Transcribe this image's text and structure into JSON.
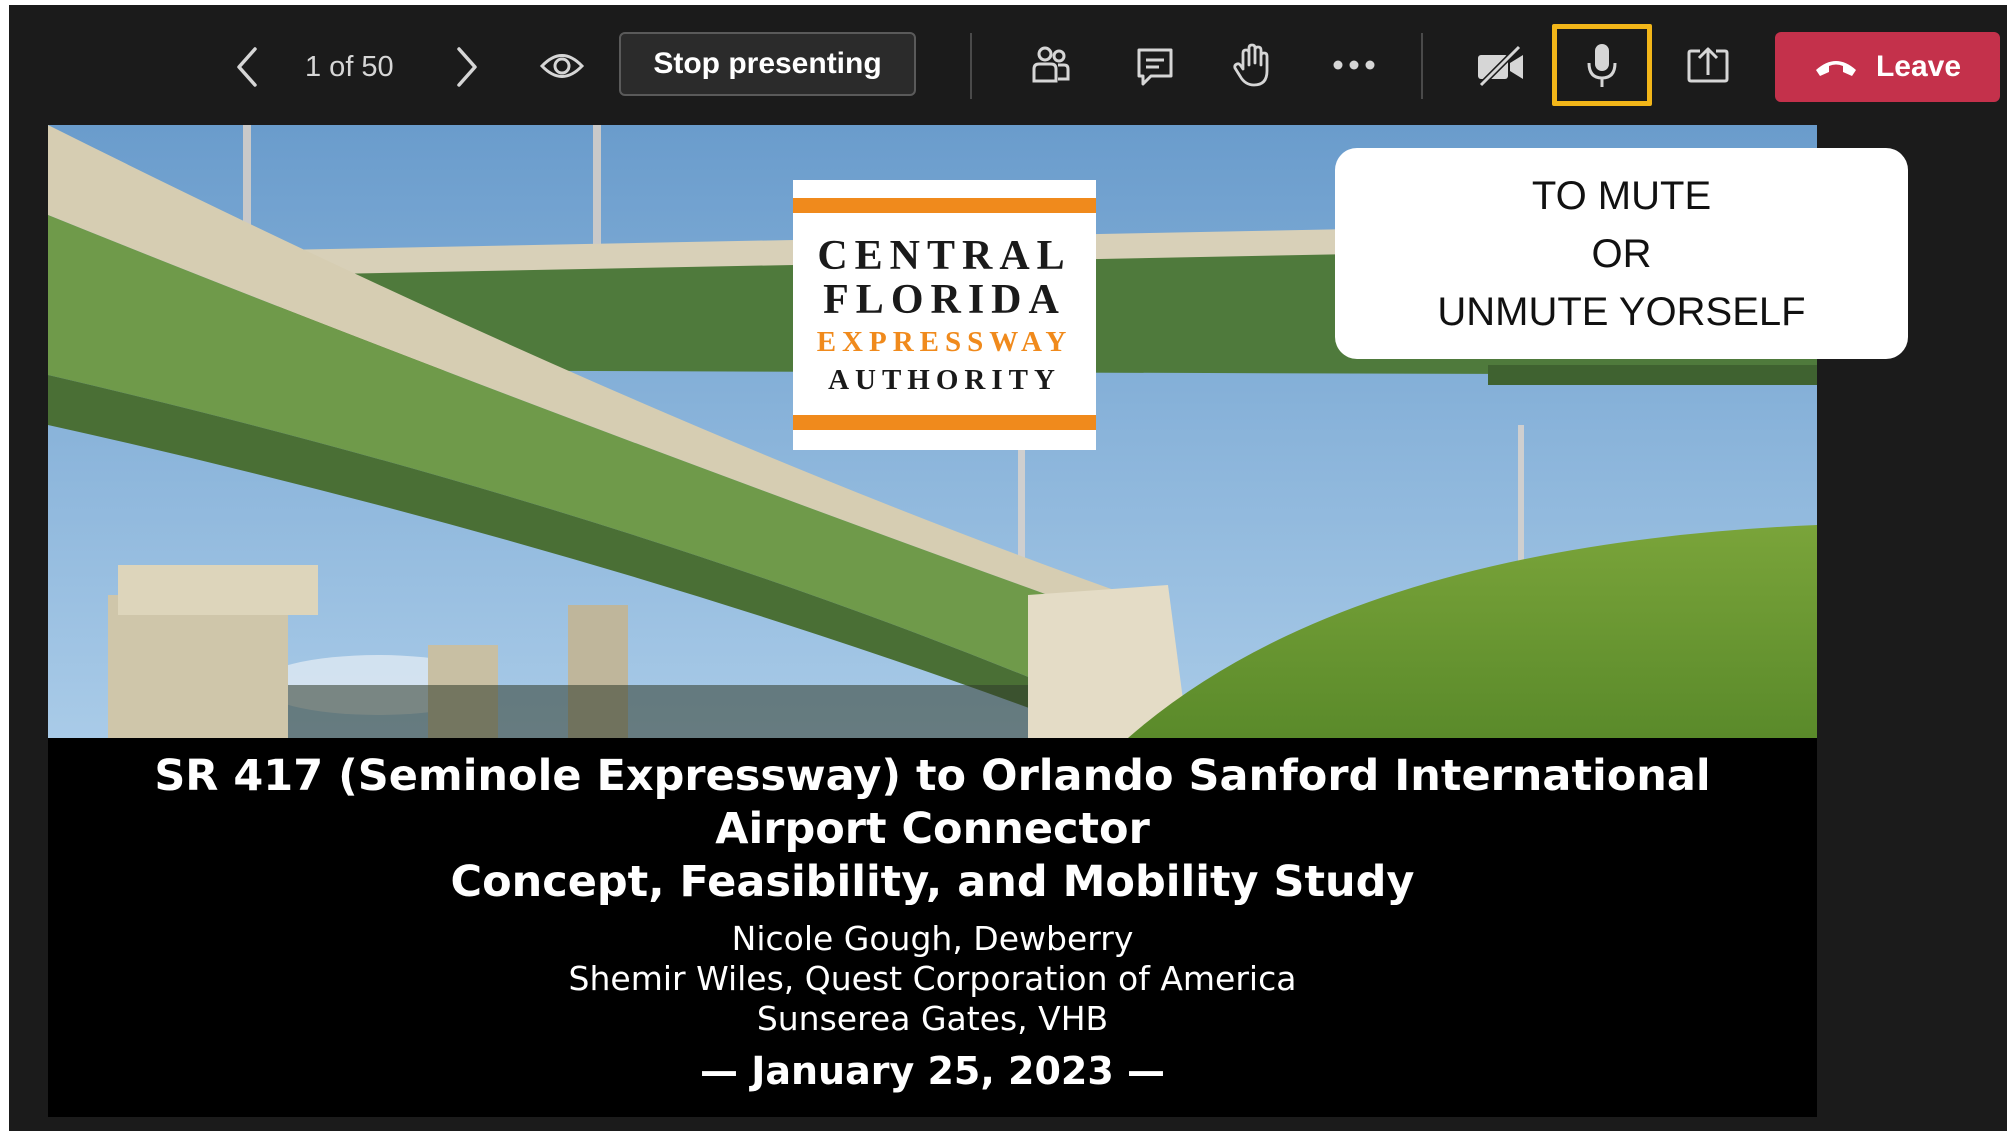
{
  "toolbar": {
    "slide_counter": "1 of 50",
    "stop_presenting_label": "Stop presenting",
    "leave_label": "Leave",
    "icons": [
      "chevron-left-icon",
      "chevron-right-icon",
      "eye-icon",
      "people-icon",
      "chat-icon",
      "raise-hand-icon",
      "more-icon",
      "camera-off-icon",
      "microphone-icon",
      "share-icon",
      "phone-hangup-icon"
    ],
    "highlight_color": "#f2b619",
    "leave_color": "#c4314b"
  },
  "callout": {
    "line1": "TO MUTE",
    "line2": "OR",
    "line3": "UNMUTE YORSELF"
  },
  "slide": {
    "logo": {
      "line1": "CENTRAL",
      "line2": "FLORIDA",
      "line3": "EXPRESSWAY",
      "line4": "AUTHORITY",
      "accent_color": "#f08a1c"
    },
    "title_line1": "SR 417 (Seminole Expressway) to Orlando Sanford International",
    "title_line2": "Airport Connector",
    "title_line3": "Concept, Feasibility, and Mobility Study",
    "author1": "Nicole Gough, Dewberry",
    "author2": "Shemir Wiles, Quest Corporation of America",
    "author3": "Sunserea Gates, VHB",
    "date": "— January 25, 2023 —"
  }
}
